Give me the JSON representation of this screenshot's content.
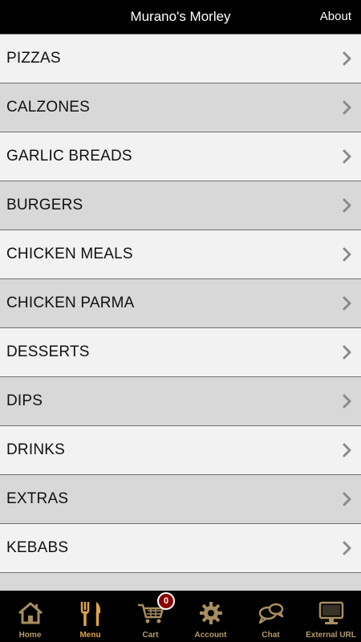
{
  "header": {
    "title": "Murano's Morley",
    "about_label": "About"
  },
  "menu": {
    "items": [
      {
        "label": "PIZZAS"
      },
      {
        "label": "CALZONES"
      },
      {
        "label": "GARLIC BREADS"
      },
      {
        "label": "BURGERS"
      },
      {
        "label": "CHICKEN MEALS"
      },
      {
        "label": "CHICKEN PARMA"
      },
      {
        "label": "DESSERTS"
      },
      {
        "label": "DIPS"
      },
      {
        "label": "DRINKS"
      },
      {
        "label": "EXTRAS"
      },
      {
        "label": "KEBABS"
      },
      {
        "label": ""
      }
    ]
  },
  "tabbar": {
    "tabs": [
      {
        "label": "Home",
        "icon": "house-icon"
      },
      {
        "label": "Menu",
        "icon": "fork-knife-icon",
        "active": true
      },
      {
        "label": "Cart",
        "icon": "cart-icon",
        "badge": "0"
      },
      {
        "label": "Account",
        "icon": "gear-icon"
      },
      {
        "label": "Chat",
        "icon": "chat-bubbles-icon"
      },
      {
        "label": "External URL",
        "icon": "monitor-icon"
      }
    ]
  },
  "colors": {
    "tab_label": "#b59a6a",
    "tab_active": "#e0a24a",
    "badge": "#8b0000",
    "row_light": "#f2f2f2",
    "row_dark": "#d8d8d8"
  }
}
